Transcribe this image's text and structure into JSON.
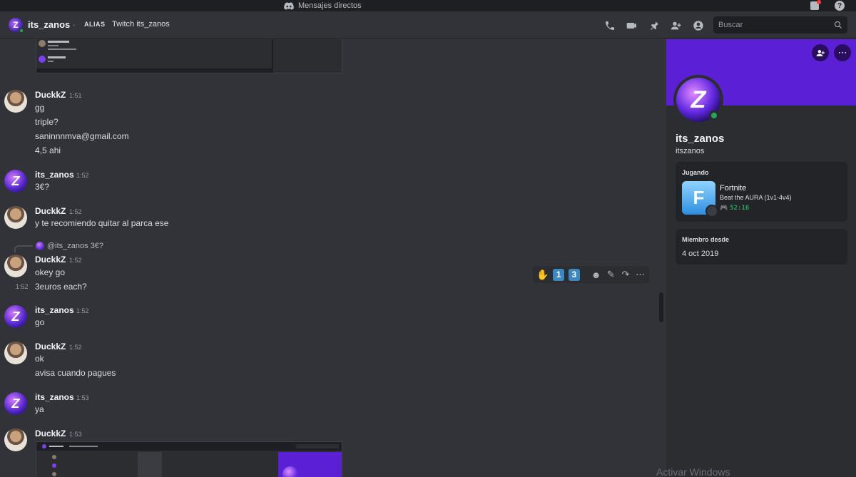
{
  "window": {
    "title": "Mensajes directos"
  },
  "header": {
    "name": "its_zanos",
    "alias_label": "ALIAS",
    "alias_value": "Twitch its_zanos",
    "search_placeholder": "Buscar"
  },
  "messages": [
    {
      "user": "DuckkZ",
      "time": "1:51",
      "lines": [
        "gg",
        "triple?",
        "saninnnmva@gmail.com",
        "4,5 ahi"
      ]
    },
    {
      "user": "its_zanos",
      "time": "1:52",
      "lines": [
        "3€?"
      ]
    },
    {
      "user": "DuckkZ",
      "time": "1:52",
      "lines": [
        "y te recomiendo quitar al parca ese"
      ]
    },
    {
      "user": "DuckkZ",
      "time": "1:52",
      "reply": "@its_zanos 3€?",
      "lines": [
        "okey go",
        "3euros each?"
      ],
      "side_time": "1:52"
    },
    {
      "user": "its_zanos",
      "time": "1:52",
      "lines": [
        "go"
      ]
    },
    {
      "user": "DuckkZ",
      "time": "1:52",
      "lines": [
        "ok",
        "avisa cuando pagues"
      ]
    },
    {
      "user": "its_zanos",
      "time": "1:53",
      "lines": [
        "ya"
      ]
    },
    {
      "user": "DuckkZ",
      "time": "1:53",
      "lines": []
    }
  ],
  "toolbar": {
    "emoji1": "✋",
    "emoji2": "1",
    "emoji3": "3"
  },
  "profile": {
    "display_name": "its_zanos",
    "username": "itszanos",
    "activity_title": "Jugando",
    "game": "Fortnite",
    "game_desc": "Beat the AURA (1v1-4v4)",
    "game_time": "52:16",
    "member_title": "Miembro desde",
    "member_date": "4 oct 2019"
  },
  "watermark": "Activar Windows"
}
